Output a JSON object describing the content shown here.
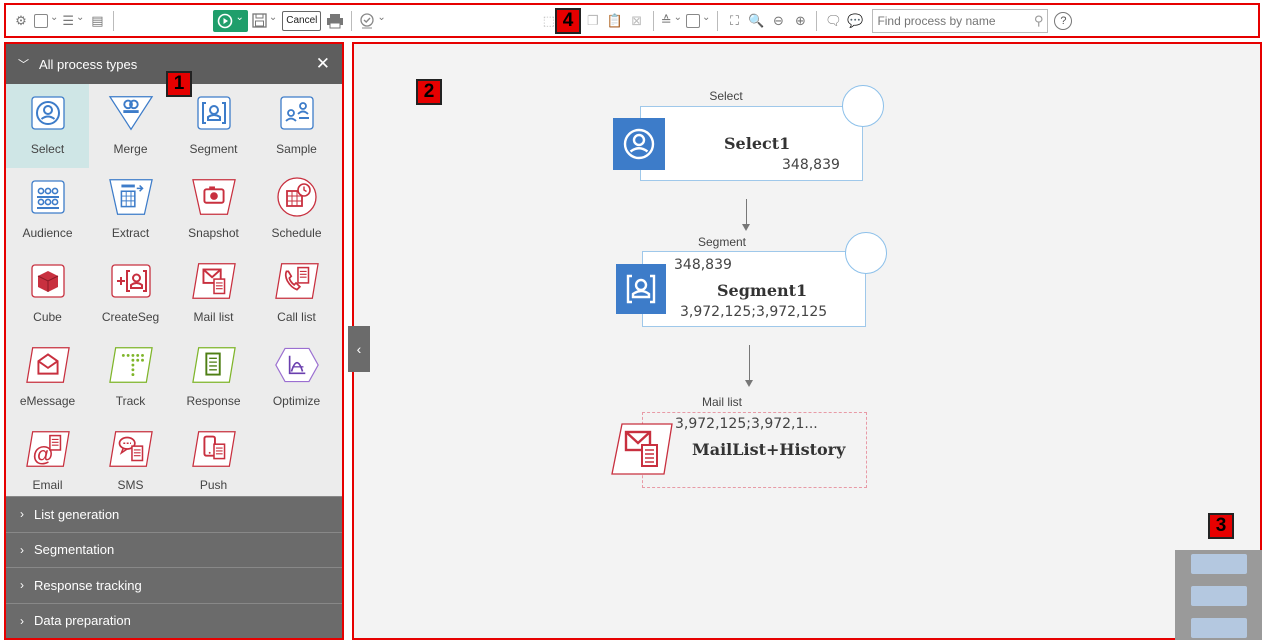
{
  "callouts": [
    "1",
    "2",
    "3",
    "4"
  ],
  "toolbar": {
    "cancel_label": "Cancel",
    "search_placeholder": "Find process by name",
    "help_label": "?"
  },
  "palette": {
    "title": "All process types",
    "items": [
      {
        "label": "Select",
        "icon": "select-icon"
      },
      {
        "label": "Merge",
        "icon": "merge-icon"
      },
      {
        "label": "Segment",
        "icon": "segment-icon"
      },
      {
        "label": "Sample",
        "icon": "sample-icon"
      },
      {
        "label": "Audience",
        "icon": "audience-icon"
      },
      {
        "label": "Extract",
        "icon": "extract-icon"
      },
      {
        "label": "Snapshot",
        "icon": "snapshot-icon"
      },
      {
        "label": "Schedule",
        "icon": "schedule-icon"
      },
      {
        "label": "Cube",
        "icon": "cube-icon"
      },
      {
        "label": "CreateSeg",
        "icon": "createseg-icon"
      },
      {
        "label": "Mail list",
        "icon": "mail-list-icon"
      },
      {
        "label": "Call list",
        "icon": "call-list-icon"
      },
      {
        "label": "eMessage",
        "icon": "emessage-icon"
      },
      {
        "label": "Track",
        "icon": "track-icon"
      },
      {
        "label": "Response",
        "icon": "response-icon"
      },
      {
        "label": "Optimize",
        "icon": "optimize-icon"
      },
      {
        "label": "Email",
        "icon": "email-icon"
      },
      {
        "label": "SMS",
        "icon": "sms-icon"
      },
      {
        "label": "Push",
        "icon": "push-icon"
      }
    ],
    "sections": [
      "List generation",
      "Segmentation",
      "Response tracking",
      "Data preparation"
    ]
  },
  "flowchart": {
    "nodes": [
      {
        "type": "Select",
        "name": "Select1",
        "count_top": "",
        "count_bottom": "348,839"
      },
      {
        "type": "Segment",
        "name": "Segment1",
        "count_top": "348,839",
        "count_bottom": "3,972,125;3,972,125"
      },
      {
        "type": "Mail list",
        "name": "MailList+History",
        "count_top": "3,972,125;3,972,1...",
        "count_bottom": ""
      }
    ]
  },
  "colors": {
    "highlight_border": "#e60000",
    "run_button": "#1f9e6b",
    "node_blue": "#3d7cc9",
    "node_red": "#c8303f",
    "selected_item": "#cfe6e6"
  }
}
